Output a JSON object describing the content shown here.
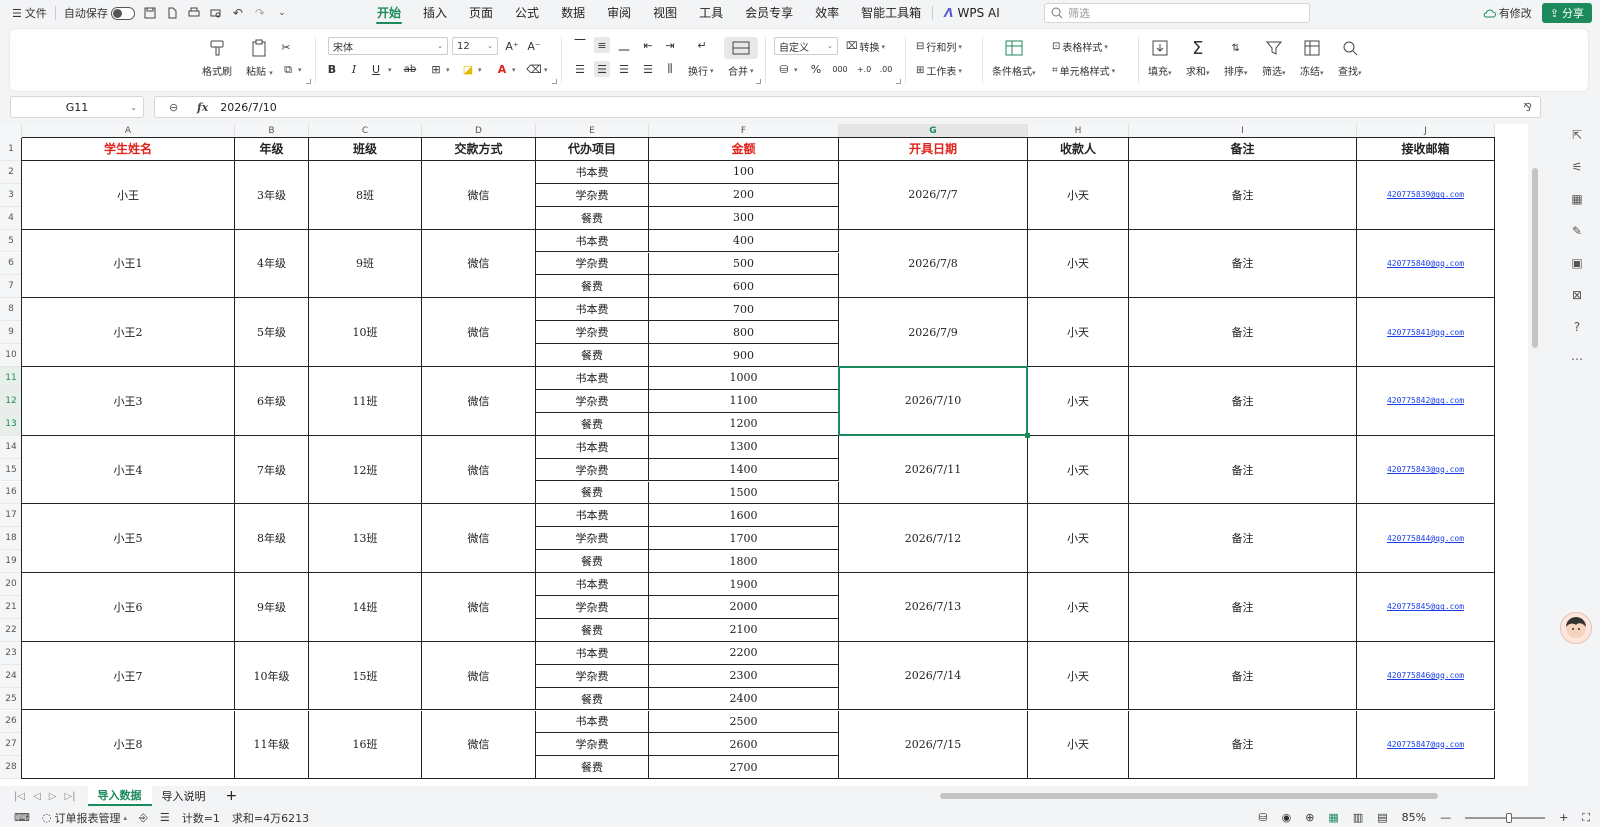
{
  "titlebar": {
    "file_menu": "文件",
    "autosave_label": "自动保存",
    "tabs": [
      "开始",
      "插入",
      "页面",
      "公式",
      "数据",
      "审阅",
      "视图",
      "工具",
      "会员专享",
      "效率",
      "智能工具箱"
    ],
    "active_tab": "开始",
    "wps_ai": "WPS AI",
    "search_placeholder": "筛选",
    "changes": "有修改",
    "share": "分享"
  },
  "ribbon": {
    "format_painter": "格式刷",
    "paste": "粘贴",
    "font_name": "宋体",
    "font_size": "12",
    "wrap": "换行",
    "merge": "合并",
    "number_format": "自定义",
    "convert": "转换",
    "rows_cols": "行和列",
    "worksheet": "工作表",
    "conditional_format": "条件格式",
    "table_style": "表格样式",
    "cell_style": "单元格样式",
    "fill": "填充",
    "sum": "求和",
    "sort": "排序",
    "filter": "筛选",
    "freeze": "冻结",
    "find": "查找",
    "bold": "B",
    "italic": "I",
    "underline": "U",
    "strike": "ab",
    "percent": "%",
    "thousands": "000",
    "dec_inc": "+.0",
    "dec_dec": ".00"
  },
  "formula_bar": {
    "name_box": "G11",
    "fx": "fx",
    "value": "2026/7/10"
  },
  "columns": [
    "A",
    "B",
    "C",
    "D",
    "E",
    "F",
    "G",
    "H",
    "I",
    "J"
  ],
  "selected_column": "G",
  "row_numbers": [
    "1",
    "2",
    "3",
    "4",
    "5",
    "6",
    "7",
    "8",
    "9",
    "10",
    "11",
    "12",
    "13",
    "14",
    "15",
    "16",
    "17",
    "18",
    "19",
    "20",
    "21",
    "22",
    "23",
    "24",
    "25",
    "26",
    "27",
    "28"
  ],
  "header_row": [
    "学生姓名",
    "年级",
    "班级",
    "交款方式",
    "代办项目",
    "金额",
    "开具日期",
    "收款人",
    "备注",
    "接收邮箱"
  ],
  "header_red": [
    true,
    false,
    false,
    false,
    false,
    true,
    true,
    false,
    false,
    false
  ],
  "groups": [
    {
      "name": "小王",
      "grade": "3年级",
      "class": "8班",
      "pay": "微信",
      "items": [
        "书本费",
        "学杂费",
        "餐费"
      ],
      "amounts": [
        "100",
        "200",
        "300"
      ],
      "date": "2026/7/7",
      "payee": "小天",
      "note": "备注",
      "email": "420775839@qq.com"
    },
    {
      "name": "小王1",
      "grade": "4年级",
      "class": "9班",
      "pay": "微信",
      "items": [
        "书本费",
        "学杂费",
        "餐费"
      ],
      "amounts": [
        "400",
        "500",
        "600"
      ],
      "date": "2026/7/8",
      "payee": "小天",
      "note": "备注",
      "email": "420775840@qq.com"
    },
    {
      "name": "小王2",
      "grade": "5年级",
      "class": "10班",
      "pay": "微信",
      "items": [
        "书本费",
        "学杂费",
        "餐费"
      ],
      "amounts": [
        "700",
        "800",
        "900"
      ],
      "date": "2026/7/9",
      "payee": "小天",
      "note": "备注",
      "email": "420775841@qq.com"
    },
    {
      "name": "小王3",
      "grade": "6年级",
      "class": "11班",
      "pay": "微信",
      "items": [
        "书本费",
        "学杂费",
        "餐费"
      ],
      "amounts": [
        "1000",
        "1100",
        "1200"
      ],
      "date": "2026/7/10",
      "payee": "小天",
      "note": "备注",
      "email": "420775842@qq.com"
    },
    {
      "name": "小王4",
      "grade": "7年级",
      "class": "12班",
      "pay": "微信",
      "items": [
        "书本费",
        "学杂费",
        "餐费"
      ],
      "amounts": [
        "1300",
        "1400",
        "1500"
      ],
      "date": "2026/7/11",
      "payee": "小天",
      "note": "备注",
      "email": "420775843@qq.com"
    },
    {
      "name": "小王5",
      "grade": "8年级",
      "class": "13班",
      "pay": "微信",
      "items": [
        "书本费",
        "学杂费",
        "餐费"
      ],
      "amounts": [
        "1600",
        "1700",
        "1800"
      ],
      "date": "2026/7/12",
      "payee": "小天",
      "note": "备注",
      "email": "420775844@qq.com"
    },
    {
      "name": "小王6",
      "grade": "9年级",
      "class": "14班",
      "pay": "微信",
      "items": [
        "书本费",
        "学杂费",
        "餐费"
      ],
      "amounts": [
        "1900",
        "2000",
        "2100"
      ],
      "date": "2026/7/13",
      "payee": "小天",
      "note": "备注",
      "email": "420775845@qq.com"
    },
    {
      "name": "小王7",
      "grade": "10年级",
      "class": "15班",
      "pay": "微信",
      "items": [
        "书本费",
        "学杂费",
        "餐费"
      ],
      "amounts": [
        "2200",
        "2300",
        "2400"
      ],
      "date": "2026/7/14",
      "payee": "小天",
      "note": "备注",
      "email": "420775846@qq.com"
    },
    {
      "name": "小王8",
      "grade": "11年级",
      "class": "16班",
      "pay": "微信",
      "items": [
        "书本费",
        "学杂费",
        "餐费"
      ],
      "amounts": [
        "2500",
        "2600",
        "2700"
      ],
      "date": "2026/7/15",
      "payee": "小天",
      "note": "备注",
      "email": "420775847@qq.com"
    }
  ],
  "sheets": [
    "导入数据",
    "导入说明"
  ],
  "active_sheet": "导入数据",
  "add_sheet": "+",
  "status": {
    "report_manager": "订单报表管理",
    "count": "计数=1",
    "sum": "求和=4万6213",
    "zoom": "85%"
  },
  "colors": {
    "accent": "#1d8a5b",
    "red_header": "#e0231c",
    "link": "#1a3ee6"
  }
}
